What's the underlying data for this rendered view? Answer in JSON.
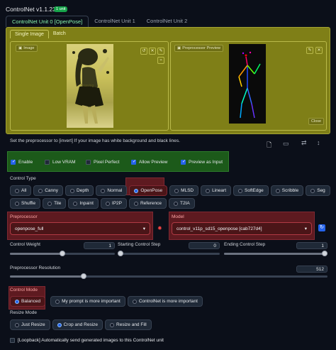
{
  "header": {
    "title": "ControlNet v1.1.233",
    "badge": "1 unit"
  },
  "units_tabs": [
    "ControlNet Unit 0 [OpenPose]",
    "ControlNet Unit 1",
    "ControlNet Unit 2"
  ],
  "image_tabs": [
    "Single Image",
    "Batch"
  ],
  "image_panel": {
    "label": "Image",
    "preview_label": "Preprocessor Preview",
    "photo_caption": "Drawing",
    "close_label": "Close"
  },
  "hint": "Set the preprocessor to [invert] If your image has white background and black lines.",
  "checkboxes": [
    {
      "label": "Enable",
      "checked": true
    },
    {
      "label": "Low VRAM",
      "checked": false
    },
    {
      "label": "Pixel Perfect",
      "checked": false
    },
    {
      "label": "Allow Preview",
      "checked": true
    },
    {
      "label": "Preview as Input",
      "checked": true
    }
  ],
  "control_type": {
    "label": "Control Type",
    "row1": [
      "All",
      "Canny",
      "Depth",
      "Normal",
      "OpenPose",
      "MLSD",
      "Lineart",
      "SoftEdge",
      "Scribble",
      "Seg"
    ],
    "row2": [
      "Shuffle",
      "Tile",
      "Inpaint",
      "IP2P",
      "Reference",
      "T2IA"
    ],
    "selected": "OpenPose"
  },
  "preprocessor": {
    "label": "Preprocessor",
    "value": "openpose_full"
  },
  "model": {
    "label": "Model",
    "value": "control_v11p_sd15_openpose [cab727d4]"
  },
  "sliders": {
    "control_weight": {
      "label": "Control Weight",
      "value": "1",
      "fraction": 0.5
    },
    "start_step": {
      "label": "Starting Control Step",
      "value": "0",
      "fraction": 0
    },
    "end_step": {
      "label": "Ending Control Step",
      "value": "1",
      "fraction": 1
    },
    "resolution": {
      "label": "Preprocessor Resolution",
      "value": "512",
      "fraction": 0.23
    }
  },
  "control_mode": {
    "label": "Control Mode",
    "options": [
      "Balanced",
      "My prompt is more important",
      "ControlNet is more important"
    ],
    "selected": "Balanced"
  },
  "resize_mode": {
    "label": "Resize Mode",
    "options": [
      "Just Resize",
      "Crop and Resize",
      "Resize and Fill"
    ],
    "selected": "Crop and Resize"
  },
  "loopback": {
    "label": "[Loopback] Automatically send generated images to this ControlNet unit",
    "checked": false
  },
  "colors": {
    "accent": "#2563eb",
    "panel": "#7f7f17",
    "highlight_red": "#5e1a20",
    "highlight_green": "#1c5a1a"
  }
}
